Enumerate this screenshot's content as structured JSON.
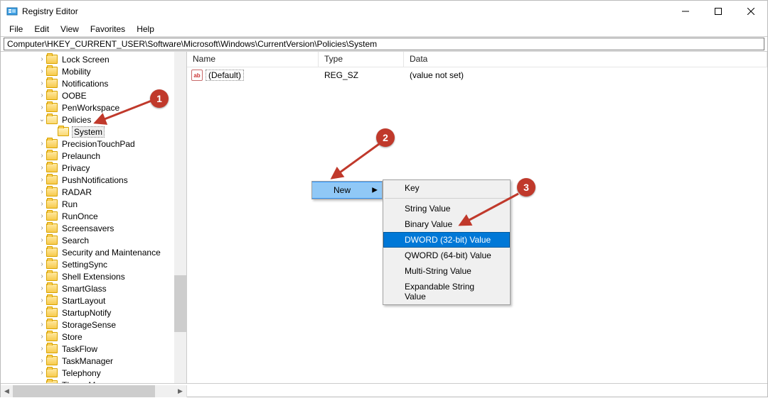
{
  "window": {
    "title": "Registry Editor"
  },
  "menu": {
    "file": "File",
    "edit": "Edit",
    "view": "View",
    "favorites": "Favorites",
    "help": "Help"
  },
  "address": {
    "path": "Computer\\HKEY_CURRENT_USER\\Software\\Microsoft\\Windows\\CurrentVersion\\Policies\\System"
  },
  "tree": {
    "items": [
      {
        "indent": 3,
        "chev": "›",
        "label": "Lock Screen"
      },
      {
        "indent": 3,
        "chev": "›",
        "label": "Mobility"
      },
      {
        "indent": 3,
        "chev": "›",
        "label": "Notifications"
      },
      {
        "indent": 3,
        "chev": "›",
        "label": "OOBE"
      },
      {
        "indent": 3,
        "chev": "›",
        "label": "PenWorkspace"
      },
      {
        "indent": 3,
        "chev": "v",
        "label": "Policies",
        "open": true
      },
      {
        "indent": 4,
        "chev": "",
        "label": "System",
        "sel": true,
        "open": true
      },
      {
        "indent": 3,
        "chev": "›",
        "label": "PrecisionTouchPad"
      },
      {
        "indent": 3,
        "chev": "›",
        "label": "Prelaunch"
      },
      {
        "indent": 3,
        "chev": "›",
        "label": "Privacy"
      },
      {
        "indent": 3,
        "chev": "›",
        "label": "PushNotifications"
      },
      {
        "indent": 3,
        "chev": "›",
        "label": "RADAR"
      },
      {
        "indent": 3,
        "chev": "›",
        "label": "Run"
      },
      {
        "indent": 3,
        "chev": "›",
        "label": "RunOnce"
      },
      {
        "indent": 3,
        "chev": "›",
        "label": "Screensavers"
      },
      {
        "indent": 3,
        "chev": "›",
        "label": "Search"
      },
      {
        "indent": 3,
        "chev": "›",
        "label": "Security and Maintenance"
      },
      {
        "indent": 3,
        "chev": "›",
        "label": "SettingSync"
      },
      {
        "indent": 3,
        "chev": "›",
        "label": "Shell Extensions"
      },
      {
        "indent": 3,
        "chev": "›",
        "label": "SmartGlass"
      },
      {
        "indent": 3,
        "chev": "›",
        "label": "StartLayout"
      },
      {
        "indent": 3,
        "chev": "›",
        "label": "StartupNotify"
      },
      {
        "indent": 3,
        "chev": "›",
        "label": "StorageSense"
      },
      {
        "indent": 3,
        "chev": "›",
        "label": "Store"
      },
      {
        "indent": 3,
        "chev": "›",
        "label": "TaskFlow"
      },
      {
        "indent": 3,
        "chev": "›",
        "label": "TaskManager"
      },
      {
        "indent": 3,
        "chev": "›",
        "label": "Telephony"
      },
      {
        "indent": 3,
        "chev": "›",
        "label": "ThemeManager"
      }
    ]
  },
  "list": {
    "columns": {
      "name": "Name",
      "type": "Type",
      "data": "Data"
    },
    "rows": [
      {
        "name": "(Default)",
        "type": "REG_SZ",
        "data": "(value not set)"
      }
    ]
  },
  "context_menu": {
    "new_label": "New",
    "submenu": [
      {
        "label": "Key"
      },
      {
        "sep": true
      },
      {
        "label": "String Value"
      },
      {
        "label": "Binary Value"
      },
      {
        "label": "DWORD (32-bit) Value",
        "hl": true
      },
      {
        "label": "QWORD (64-bit) Value"
      },
      {
        "label": "Multi-String Value"
      },
      {
        "label": "Expandable String Value"
      }
    ]
  },
  "annotations": {
    "b1": "1",
    "b2": "2",
    "b3": "3"
  }
}
